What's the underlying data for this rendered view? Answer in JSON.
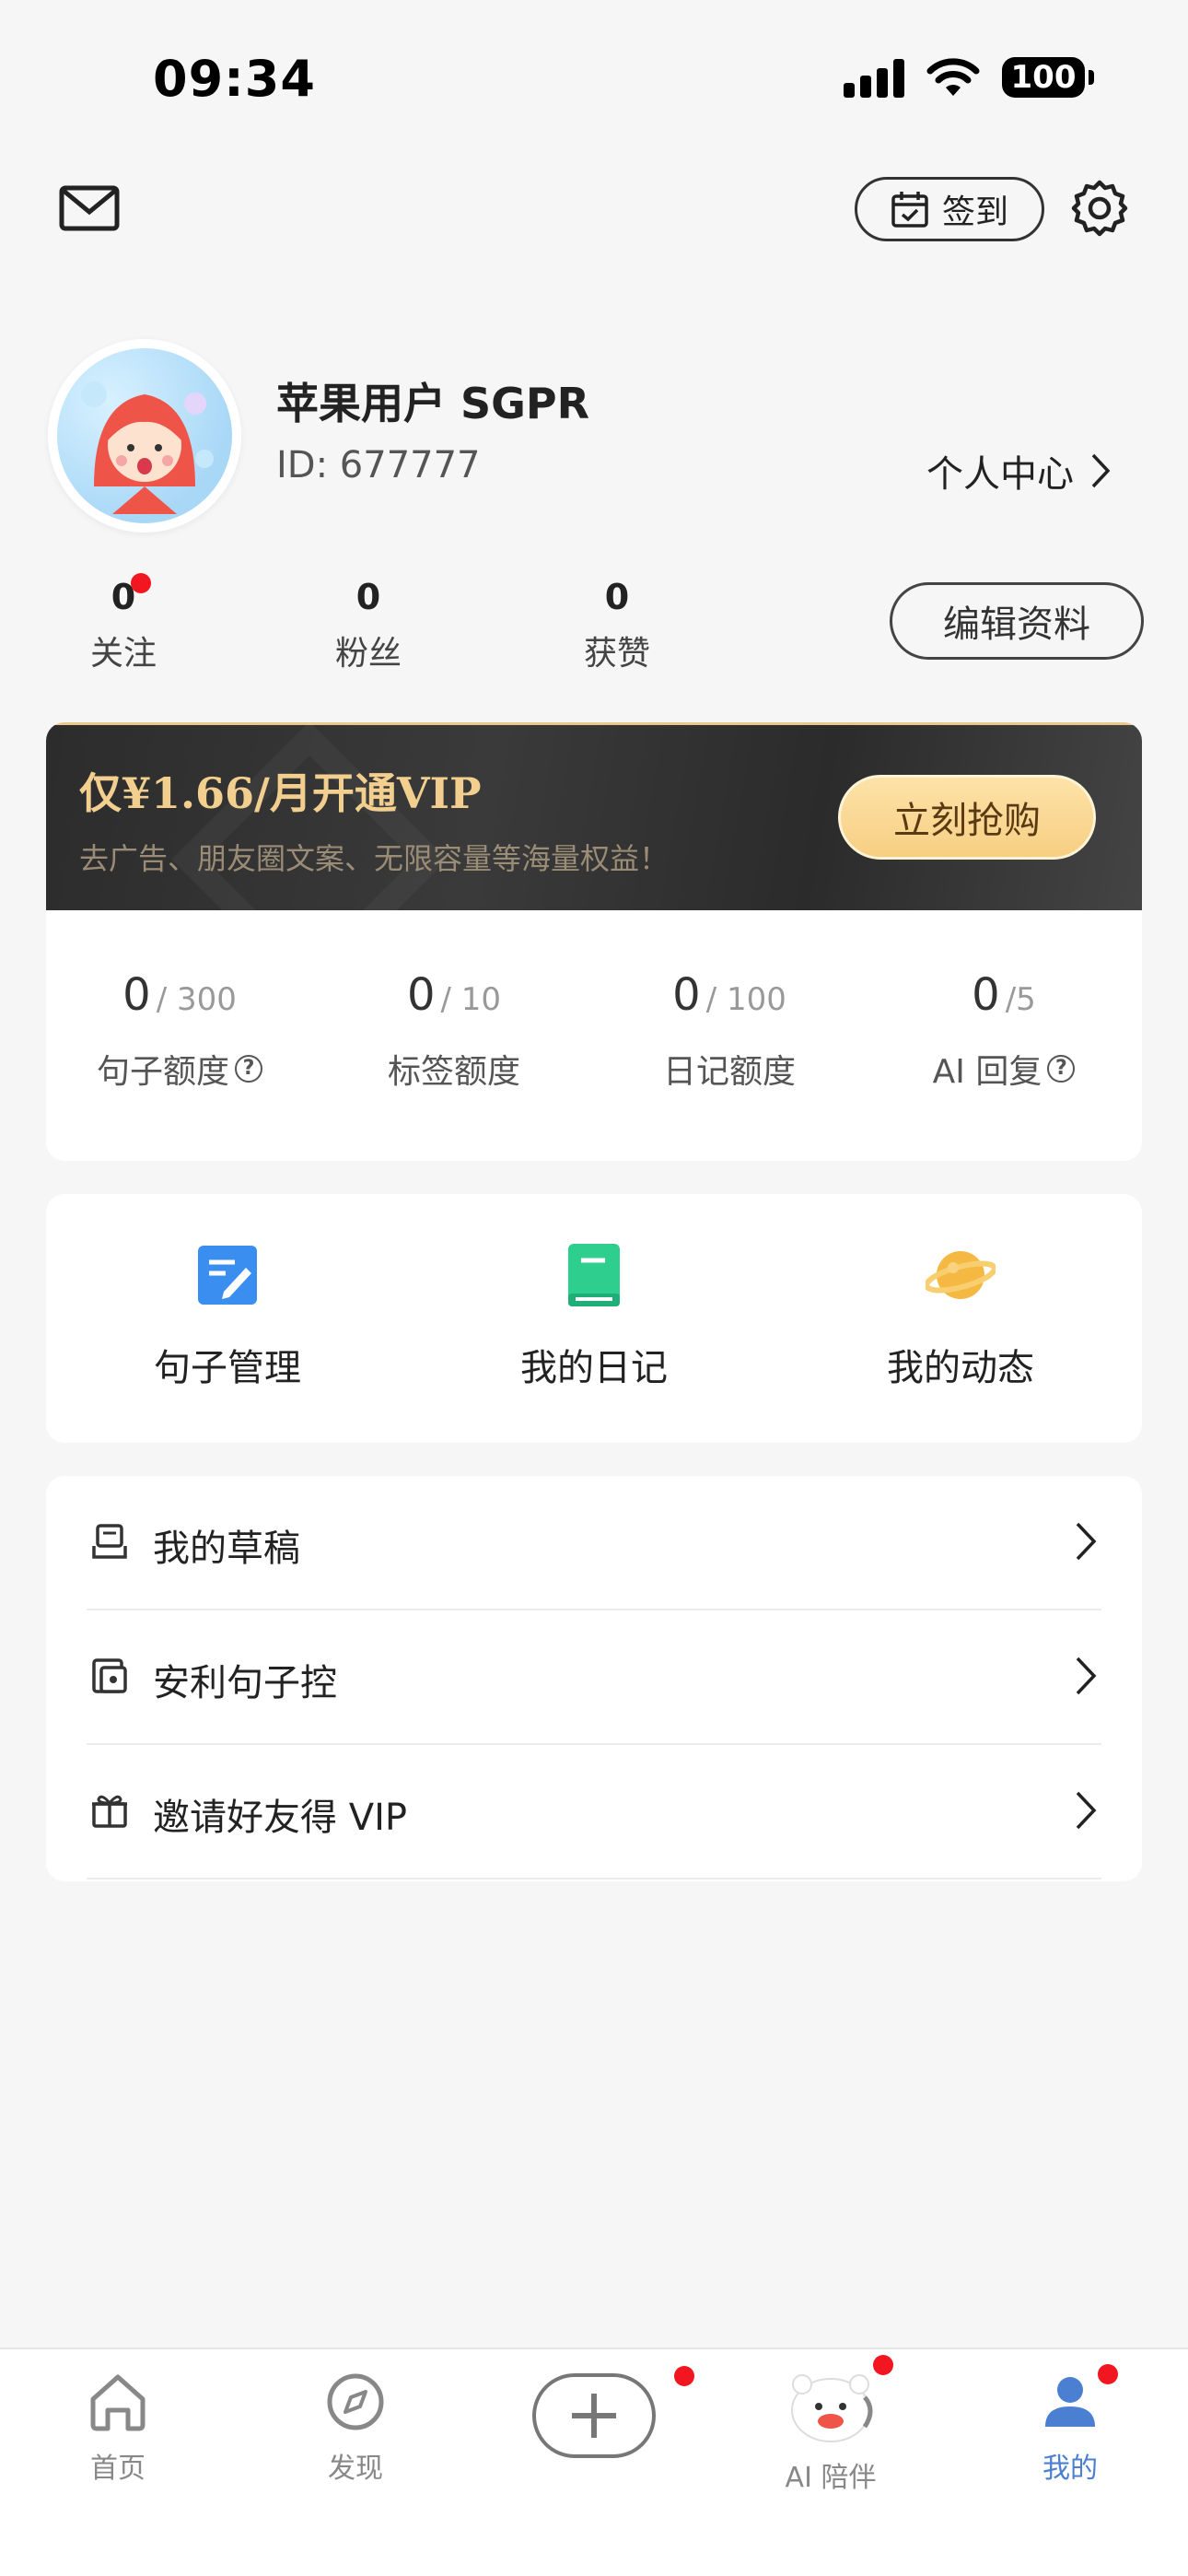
{
  "status_bar": {
    "time": "09:34",
    "battery": "100"
  },
  "top_bar": {
    "checkin_label": "签到"
  },
  "profile": {
    "username": "苹果用户 SGPR",
    "user_id": "ID: 677777",
    "center_link": "个人中心",
    "edit_label": "编辑资料"
  },
  "stats": [
    {
      "value": "0",
      "label": "关注"
    },
    {
      "value": "0",
      "label": "粉丝"
    },
    {
      "value": "0",
      "label": "获赞"
    }
  ],
  "vip": {
    "title": "仅¥1.66/月开通VIP",
    "subtitle": "去广告、朋友圈文案、无限容量等海量权益！",
    "buy_label": "立刻抢购"
  },
  "quotas": [
    {
      "used": "0",
      "limit": "/ 300",
      "label": "句子额度"
    },
    {
      "used": "0",
      "limit": "/ 10",
      "label": "标签额度"
    },
    {
      "used": "0",
      "limit": "/ 100",
      "label": "日记额度"
    },
    {
      "used": "0",
      "limit": "/5",
      "label": "AI 回复"
    }
  ],
  "features": [
    {
      "label": "句子管理",
      "icon": "edit-document-icon",
      "color": "#3a8ef0"
    },
    {
      "label": "我的日记",
      "icon": "diary-book-icon",
      "color": "#2ecf8e"
    },
    {
      "label": "我的动态",
      "icon": "planet-icon",
      "color": "#f5b843"
    }
  ],
  "menu": [
    {
      "label": "我的草稿",
      "icon": "draft-icon"
    },
    {
      "label": "安利句子控",
      "icon": "share-recommend-icon"
    },
    {
      "label": "邀请好友得 VIP",
      "icon": "gift-icon"
    }
  ],
  "tabs": [
    {
      "label": "首页",
      "icon": "home-icon"
    },
    {
      "label": "发现",
      "icon": "compass-icon"
    },
    {
      "label": "AI 陪伴",
      "icon": "ai-companion-avatar"
    },
    {
      "label": "我的",
      "icon": "person-icon"
    }
  ],
  "colors": {
    "accent": "#4b7fd1",
    "badge_red": "#f1161f",
    "vip_gold": "#f2cf8e"
  }
}
